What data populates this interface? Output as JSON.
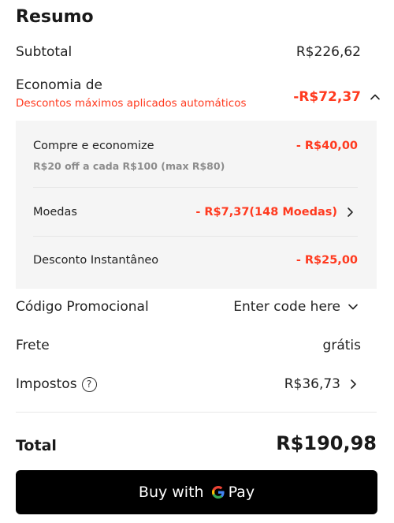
{
  "summary": {
    "title": "Resumo",
    "subtotal": {
      "label": "Subtotal",
      "value": "R$226,62"
    },
    "economia": {
      "label": "Economia de",
      "subtitle": "Descontos máximos aplicados automáticos",
      "value": "-R$72,37",
      "expanded": true,
      "items": [
        {
          "label": "Compre e economize",
          "value": "- R$40,00",
          "note": "R$20 off a cada R$100 (max R$80)"
        },
        {
          "label": "Moedas",
          "value": "- R$7,37(148 Moedas)"
        },
        {
          "label": "Desconto Instantâneo",
          "value": "- R$25,00"
        }
      ]
    },
    "promo": {
      "label": "Código Promocional",
      "placeholder": "Enter code here"
    },
    "frete": {
      "label": "Frete",
      "value": "grátis"
    },
    "impostos": {
      "label": "Impostos",
      "value": "R$36,73"
    },
    "total": {
      "label": "Total",
      "value": "R$190,98"
    }
  },
  "pay_button": {
    "prefix": "Buy with",
    "brand": "Pay"
  },
  "colors": {
    "accent": "#ff3a1f",
    "panel_bg": "#f5f5f5",
    "button_bg": "#000000"
  },
  "icons": [
    "chevron-up-icon",
    "chevron-right-icon",
    "chevron-down-icon",
    "help-icon",
    "google-g-icon"
  ]
}
